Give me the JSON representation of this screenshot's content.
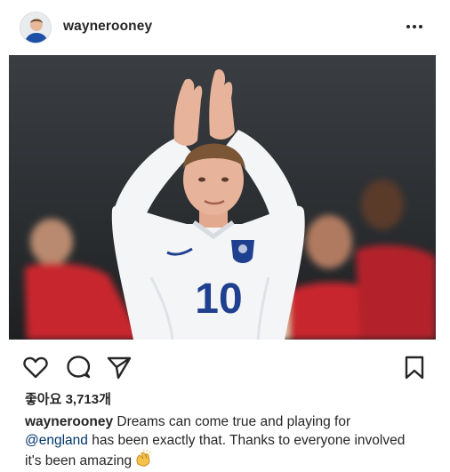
{
  "post": {
    "author": "waynerooney",
    "likes": "좋아요 3,713개",
    "caption": {
      "author": "waynerooney",
      "text_before": " Dreams can come true and playing for",
      "mention": "@england",
      "text_after": " has been exactly that. Thanks to everyone involved it's been amazing",
      "emoji": "clapping-hands-icon"
    },
    "photo": {
      "shirt_number": "10",
      "colors": {
        "kit": "#f4f5f7",
        "number": "#1f3f8f",
        "opponent_kit": "#c8262e",
        "background": "#2a2d30"
      }
    }
  },
  "icons": {
    "more": "more-options-icon",
    "like": "heart-icon",
    "comment": "comment-icon",
    "share": "share-icon",
    "save": "bookmark-icon"
  }
}
